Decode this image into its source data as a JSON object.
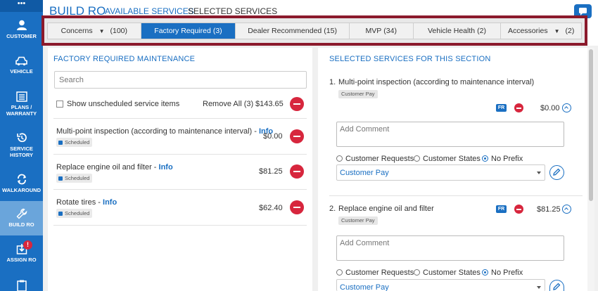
{
  "sidebar": {
    "top_icon": "•••",
    "items": [
      {
        "label_1": "CUSTOMER",
        "label_2": "",
        "icon": "person-icon"
      },
      {
        "label_1": "VEHICLE",
        "label_2": "",
        "icon": "car-icon"
      },
      {
        "label_1": "PLANS /",
        "label_2": "WARRANTY",
        "icon": "list-icon"
      },
      {
        "label_1": "SERVICE",
        "label_2": "HISTORY",
        "icon": "history-icon"
      },
      {
        "label_1": "WALKAROUND",
        "label_2": "",
        "icon": "walkaround-icon"
      },
      {
        "label_1": "BUILD RO",
        "label_2": "",
        "icon": "wrench-icon",
        "active": true
      },
      {
        "label_1": "ASSIGN RO",
        "label_2": "",
        "icon": "assign-icon",
        "badge": "!"
      },
      {
        "label_1": "",
        "label_2": "",
        "icon": "clipboard-icon"
      }
    ]
  },
  "header": {
    "title": "BUILD RO",
    "tabs": [
      "AVAILABLE SERVICES",
      "SELECTED SERVICES"
    ],
    "chat_icon": "chat-icon"
  },
  "category_tabs": [
    {
      "label": "Concerns",
      "count": "(100)",
      "dropdown": true
    },
    {
      "label": "Factory Required",
      "count": "(3)",
      "active": true
    },
    {
      "label": "Dealer Recommended",
      "count": "(15)"
    },
    {
      "label": "MVP",
      "count": "(34)"
    },
    {
      "label": "Vehicle Health",
      "count": "(2)"
    },
    {
      "label": "Accessories",
      "count": "(2)",
      "dropdown": true
    }
  ],
  "left": {
    "title": "FACTORY REQUIRED MAINTENANCE",
    "search_placeholder": "Search",
    "show_unscheduled": "Show unscheduled service items",
    "remove_all": "Remove All (3)",
    "total": "$143.65",
    "items": [
      {
        "name": "Multi-point inspection (according to maintenance interval) - ",
        "info": "Info",
        "price": "$0.00",
        "status": "Scheduled"
      },
      {
        "name": "Replace engine oil and filter - ",
        "info": "Info",
        "price": "$81.25",
        "status": "Scheduled"
      },
      {
        "name": "Rotate tires - ",
        "info": "Info",
        "price": "$62.40",
        "status": "Scheduled"
      }
    ]
  },
  "right": {
    "title": "SELECTED SERVICES FOR THIS SECTION",
    "services": [
      {
        "number": "1.",
        "name": "Multi-point inspection (according to maintenance interval)",
        "pay_type": "Customer Pay",
        "fr_badge": "FR",
        "price": "$0.00",
        "comment_placeholder": "Add Comment",
        "radios": [
          "Customer Requests",
          "Customer States",
          "No Prefix"
        ],
        "selected_radio": "No Prefix",
        "select_value": "Customer Pay"
      },
      {
        "number": "2.",
        "name": "Replace engine oil and filter",
        "pay_type": "Customer Pay",
        "fr_badge": "FR",
        "price": "$81.25",
        "comment_placeholder": "Add Comment",
        "radios": [
          "Customer Requests",
          "Customer States",
          "No Prefix"
        ],
        "selected_radio": "No Prefix",
        "select_value": "Customer Pay"
      }
    ]
  },
  "colors": {
    "brand_blue": "#1a6fc2",
    "highlight_border": "#8b1a2c",
    "danger_red": "#d7263d"
  }
}
